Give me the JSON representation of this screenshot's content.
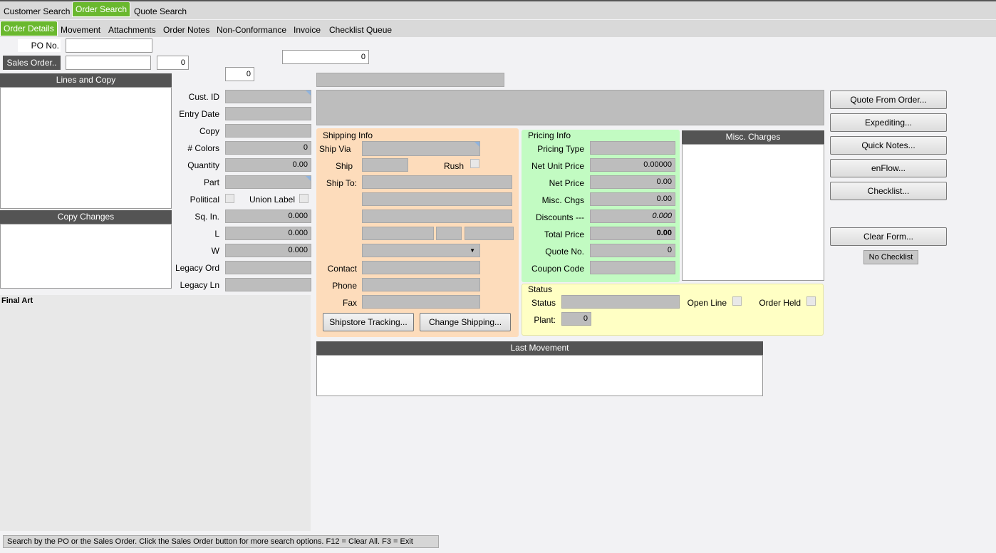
{
  "tabs": {
    "top": [
      "Customer Search",
      "Order Search",
      "Quote Search"
    ],
    "sub": [
      "Order Details",
      "Movement",
      "Attachments",
      "Order Notes",
      "Non-Conformance",
      "Invoice",
      "Checklist Queue"
    ]
  },
  "search": {
    "po_label": "PO No.",
    "po_value": "",
    "sales_order_button": "Sales Order..",
    "sales_order_value": "",
    "line_value": "0",
    "top_value": "0",
    "small_value": "0"
  },
  "left": {
    "lines_header": "Lines and Copy",
    "copy_changes_header": "Copy Changes",
    "final_art": "Final Art"
  },
  "order": {
    "cust_id": "Cust. ID",
    "entry_date": "Entry Date",
    "copy": "Copy",
    "colors": "# Colors",
    "colors_value": "0",
    "quantity": "Quantity",
    "quantity_value": "0.00",
    "part": "Part",
    "political": "Political",
    "union_label": "Union Label",
    "sq_in": "Sq. In.",
    "sq_in_value": "0.000",
    "l": "L",
    "l_value": "0.000",
    "w": "W",
    "w_value": "0.000",
    "legacy_ord": "Legacy Ord",
    "legacy_ln": "Legacy Ln"
  },
  "shipping": {
    "title": "Shipping Info",
    "ship_via": "Ship Via",
    "ship": "Ship",
    "rush": "Rush",
    "ship_to": "Ship To:",
    "contact": "Contact",
    "phone": "Phone",
    "fax": "Fax",
    "tracking_button": "Shipstore Tracking...",
    "change_button": "Change Shipping..."
  },
  "pricing": {
    "title": "Pricing Info",
    "pricing_type": "Pricing Type",
    "net_unit_price": "Net Unit Price",
    "net_unit_price_value": "0.00000",
    "net_price": "Net Price",
    "net_price_value": "0.00",
    "misc_chgs": "Misc. Chgs",
    "misc_chgs_value": "0.00",
    "discounts": "Discounts ---",
    "discounts_value": "0.000",
    "total_price": "Total Price",
    "total_price_value": "0.00",
    "quote_no": "Quote No.",
    "quote_no_value": "0",
    "coupon_code": "Coupon Code"
  },
  "misc": {
    "header": "Misc. Charges"
  },
  "status": {
    "title": "Status",
    "status": "Status",
    "open_line": "Open Line",
    "order_held": "Order Held",
    "plant": "Plant:",
    "plant_value": "0"
  },
  "last_movement": {
    "header": "Last Movement"
  },
  "actions": [
    "Quote From Order...",
    "Expediting...",
    "Quick Notes...",
    "enFlow...",
    "Checklist..."
  ],
  "clear_button": "Clear Form...",
  "checklist_badge": "No Checklist",
  "statusbar": "Search by the PO or the Sales Order. Click the Sales Order button for more search options. F12 = Clear All. F3 = Exit",
  "colors": {
    "tab_active": "#6ab82e",
    "shipping_bg": "#fddcbb",
    "pricing_bg": "#c2fbc2",
    "status_bg": "#ffffc4",
    "header_bg": "#545454"
  }
}
